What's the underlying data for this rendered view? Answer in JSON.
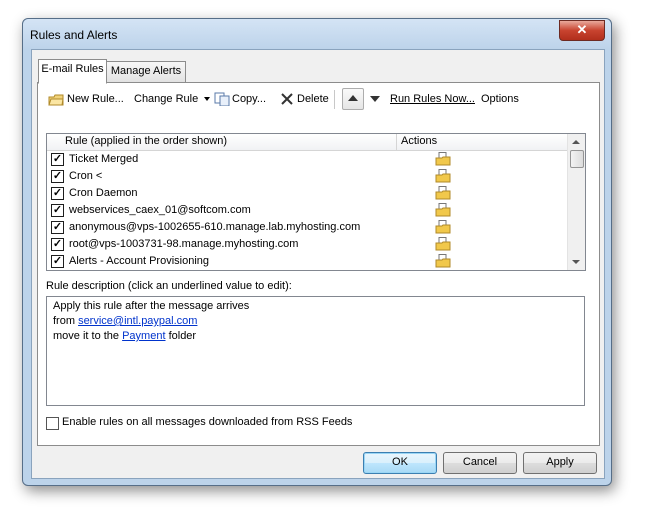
{
  "window": {
    "title": "Rules and Alerts",
    "close_glyph": "✕"
  },
  "tabs": [
    {
      "label": "E-mail Rules",
      "active": true
    },
    {
      "label": "Manage Alerts",
      "active": false
    }
  ],
  "toolbar": {
    "new_rule": "New Rule...",
    "change_rule": "Change Rule",
    "copy": "Copy...",
    "delete": "Delete",
    "run_rules_now": "Run Rules Now...",
    "options": "Options"
  },
  "rules_list": {
    "header_rule": "Rule (applied in the order shown)",
    "header_actions": "Actions",
    "rows": [
      {
        "name": "Ticket Merged",
        "checked": true
      },
      {
        "name": "Cron <",
        "checked": true
      },
      {
        "name": "Cron Daemon",
        "checked": true
      },
      {
        "name": "webservices_caex_01@softcom.com",
        "checked": true
      },
      {
        "name": "anonymous@vps-1002655-610.manage.lab.myhosting.com",
        "checked": true
      },
      {
        "name": "root@vps-1003731-98.manage.myhosting.com",
        "checked": true
      },
      {
        "name": "Alerts - Account Provisioning",
        "checked": true
      }
    ]
  },
  "description": {
    "label": "Rule description (click an underlined value to edit):",
    "line1": "Apply this rule after the message arrives",
    "line2_prefix": "from ",
    "line2_link": "service@intl.paypal.com",
    "line3_prefix": "move it to the ",
    "line3_link": "Payment",
    "line3_suffix": " folder"
  },
  "rss_option": {
    "label": "Enable rules on all messages downloaded from RSS Feeds",
    "checked": false
  },
  "buttons": {
    "ok": "OK",
    "cancel": "Cancel",
    "apply": "Apply"
  },
  "colors": {
    "accent": "#3c7fb1",
    "link": "#0033cc",
    "close": "#c8432f"
  }
}
